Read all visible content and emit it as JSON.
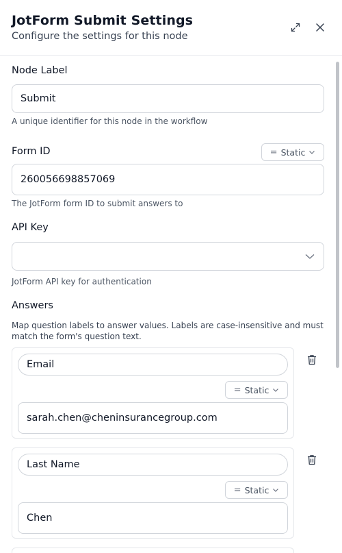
{
  "header": {
    "title": "JotForm Submit Settings",
    "subtitle": "Configure the settings for this node"
  },
  "node_label": {
    "label": "Node Label",
    "value": "Submit",
    "help": "A unique identifier for this node in the workflow"
  },
  "form_id": {
    "label": "Form ID",
    "mode": "Static",
    "value": "260056698857069",
    "help": "The JotForm form ID to submit answers to"
  },
  "api_key": {
    "label": "API Key",
    "value": "",
    "help": "JotForm API key for authentication"
  },
  "answers": {
    "label": "Answers",
    "help": "Map question labels to answer values. Labels are case-insensitive and must match the form's question text.",
    "items": [
      {
        "question": "Email",
        "mode": "Static",
        "answer": "sarah.chen@cheninsurancegroup.com"
      },
      {
        "question": "Last Name",
        "mode": "Static",
        "answer": "Chen"
      }
    ]
  },
  "icons": {
    "expand": "expand-icon",
    "close": "close-icon",
    "chevron": "chevron-down-icon",
    "trash": "trash-icon",
    "equals": "equals-icon"
  },
  "colors": {
    "border": "#d1d5db",
    "text": "#111827",
    "muted": "#4b5563"
  }
}
